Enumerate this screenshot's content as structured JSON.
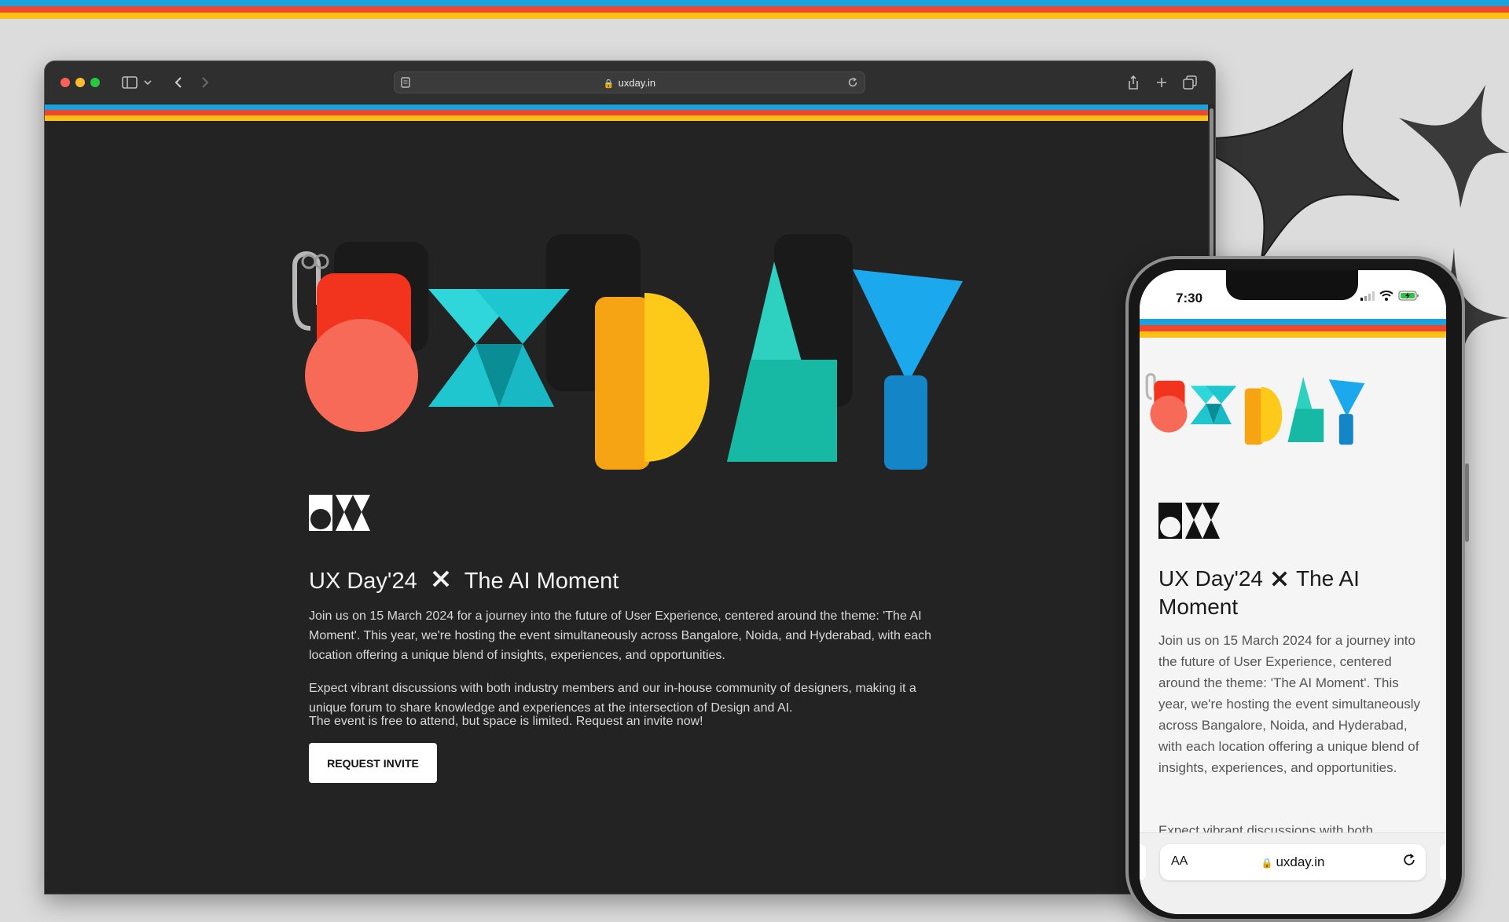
{
  "colors": {
    "blue": "#1ba1dc",
    "red": "#ef4630",
    "yellow": "#fbbf16",
    "teal": "#16c3cc",
    "dark_bg": "#232323"
  },
  "browser": {
    "url": "uxday.in",
    "icons": [
      "sidebar-icon",
      "chevron-down-icon",
      "back-icon",
      "forward-icon",
      "reader-icon",
      "lock-icon",
      "reload-icon",
      "share-icon",
      "new-tab-icon",
      "tabs-overview-icon"
    ]
  },
  "site": {
    "hero_text": "UXDAY",
    "title_left": "UX Day'24",
    "title_right": "The AI Moment",
    "paragraph_1": "Join us on 15 March 2024 for a journey into the future of User Experience, centered around the theme: 'The AI Moment'. This year, we're hosting the event simultaneously across Bangalore, Noida, and Hyderabad, with each location offering a unique blend of insights, experiences, and opportunities.",
    "paragraph_2": "Expect vibrant discussions with both industry members and our in-house community of designers, making it a unique forum to share knowledge and experiences at the intersection of Design and AI.",
    "paragraph_3": "The event is free to attend, but space is limited. Request an invite now!",
    "cta_label": "REQUEST INVITE"
  },
  "phone": {
    "time": "7:30",
    "title": "UX Day'24",
    "title_right": "The AI Moment",
    "paragraph_1": "Join us on 15 March 2024 for a journey into the future of User Experience, centered around the theme: 'The AI Moment'. This year, we're hosting the event simultaneously across Bangalore, Noida, and Hyderabad, with each location offering a unique blend of insights, experiences, and opportunities.",
    "paragraph_2_partial": "Expect vibrant discussions with both",
    "text_size_label": "AA",
    "url": "uxday.in"
  }
}
